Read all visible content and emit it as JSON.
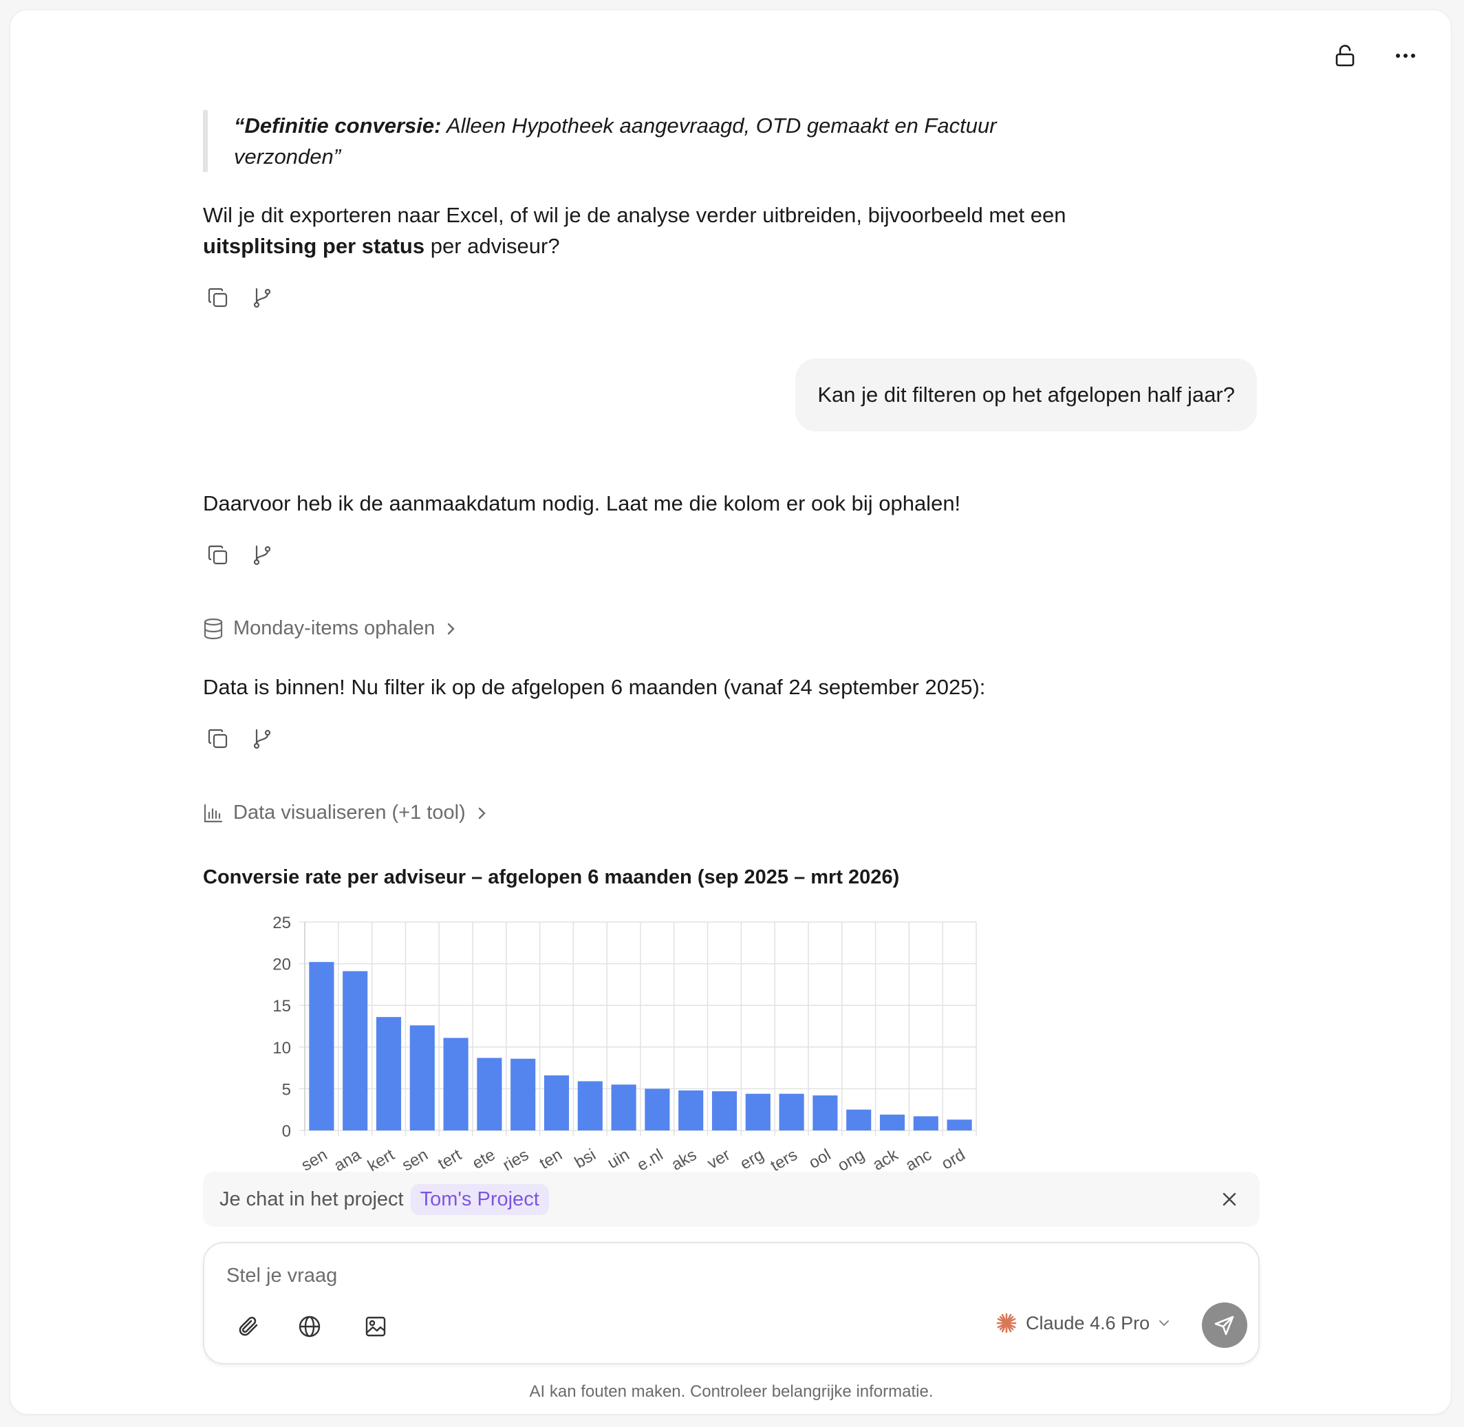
{
  "quote": {
    "bold_part": "“Definitie conversie:",
    "rest_part": " Alleen Hypotheek aangevraagd, OTD gemaakt en Factuur verzonden”"
  },
  "assistant_msg_1": {
    "text_before": "Wil je dit exporteren naar Excel, of wil je de analyse verder uitbreiden, bijvoorbeeld met een ",
    "bold": "uitsplitsing per status",
    "text_after": " per adviseur?"
  },
  "user_msg": "Kan je dit filteren op het afgelopen half jaar?",
  "assistant_msg_2": "Daarvoor heb ik de aanmaakdatum nodig. Laat me die kolom er ook bij ophalen!",
  "tool_1": "Monday-items ophalen",
  "assistant_msg_3": "Data is binnen! Nu filter ik op de afgelopen 6 maanden (vanaf 24 september 2025):",
  "tool_2": "Data visualiseren (+1 tool)",
  "chart_data": {
    "type": "bar",
    "title": "Conversie rate per adviseur – afgelopen 6 maanden (sep 2025 – mrt 2026)",
    "ylim": [
      0,
      25
    ],
    "yticks": [
      "0",
      "5",
      "10",
      "15",
      "20",
      "25"
    ],
    "categories": [
      "sen",
      "ana",
      "kert",
      "sen",
      "tert",
      "ete",
      "ries",
      "ten",
      "bsi",
      "uin",
      "e.nl",
      "aks",
      "ver",
      "erg",
      "ters",
      "ool",
      "ong",
      "ack",
      "anc",
      "ord"
    ],
    "values": [
      20.2,
      19.1,
      13.6,
      12.6,
      11.1,
      8.7,
      8.6,
      6.6,
      5.9,
      5.5,
      5.0,
      4.8,
      4.7,
      4.4,
      4.4,
      4.2,
      2.5,
      1.9,
      1.7,
      1.3
    ],
    "grid": true,
    "bar_color": "#5484ee"
  },
  "project_bar": {
    "label": "Je chat in het project",
    "project": "Tom's Project"
  },
  "composer": {
    "placeholder": "Stel je vraag",
    "model": "Claude 4.6 Pro"
  },
  "footer": "AI kan fouten maken. Controleer belangrijke informatie."
}
